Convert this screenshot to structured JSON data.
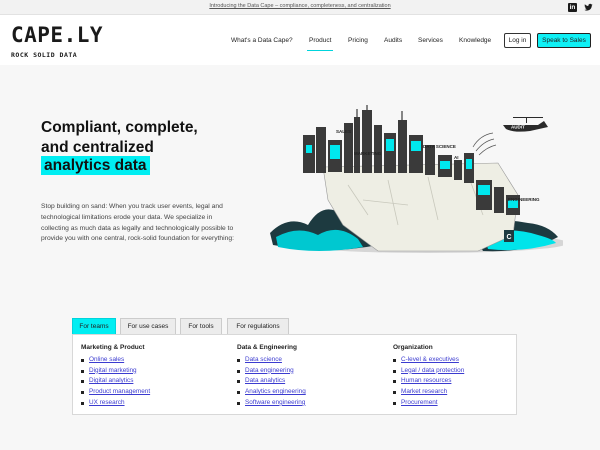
{
  "topbar": {
    "announcement": "Introducing the Data Cape – compliance, completeness, and centralization",
    "linkedin_glyph": "in"
  },
  "logo": {
    "word": "CAPE.LY",
    "tagline": "ROCK SOLID DATA"
  },
  "nav": {
    "items": [
      {
        "label": "What's a Data Cape?"
      },
      {
        "label": "Product"
      },
      {
        "label": "Pricing"
      },
      {
        "label": "Audits"
      },
      {
        "label": "Services"
      },
      {
        "label": "Knowledge"
      }
    ],
    "active": "Product",
    "login": "Log in",
    "sales": "Speak to Sales"
  },
  "hero": {
    "headline_line1": "Compliant, complete,",
    "headline_line2": "and centralized",
    "headline_highlight": "analytics data",
    "description": "Stop building on sand: When you track user events, legal and technological limitations erode your data. We specialize in collecting as much data as legally and technologically possible to provide you with one central, rock-solid foundation for everything:"
  },
  "illustration": {
    "labels": {
      "sales": "SALES",
      "marketing": "MARKETING",
      "data_science": "DATA SCIENCE",
      "ai": "AI",
      "engineering": "ENGINEERING",
      "audit": "AUDIT",
      "cape": "C"
    }
  },
  "tabs": [
    {
      "label": "For teams"
    },
    {
      "label": "For use cases"
    },
    {
      "label": "For tools"
    },
    {
      "label": "For regulations"
    }
  ],
  "active_tab": "For teams",
  "columns": [
    {
      "heading": "Marketing & Product",
      "items": [
        "Online sales",
        "Digital marketing",
        "Digital analytics",
        "Product management",
        "UX research"
      ]
    },
    {
      "heading": "Data & Engineering",
      "items": [
        "Data science",
        "Data engineering",
        "Data analytics",
        "Analytics engineering",
        "Software engineering"
      ]
    },
    {
      "heading": "Organization",
      "items": [
        "C-level & executives",
        "Legal / data protection",
        "Human resources",
        "Market research",
        "Procurement"
      ]
    }
  ],
  "colors": {
    "accent": "#00eef2",
    "link": "#3b3bd0",
    "ink": "#222222"
  }
}
